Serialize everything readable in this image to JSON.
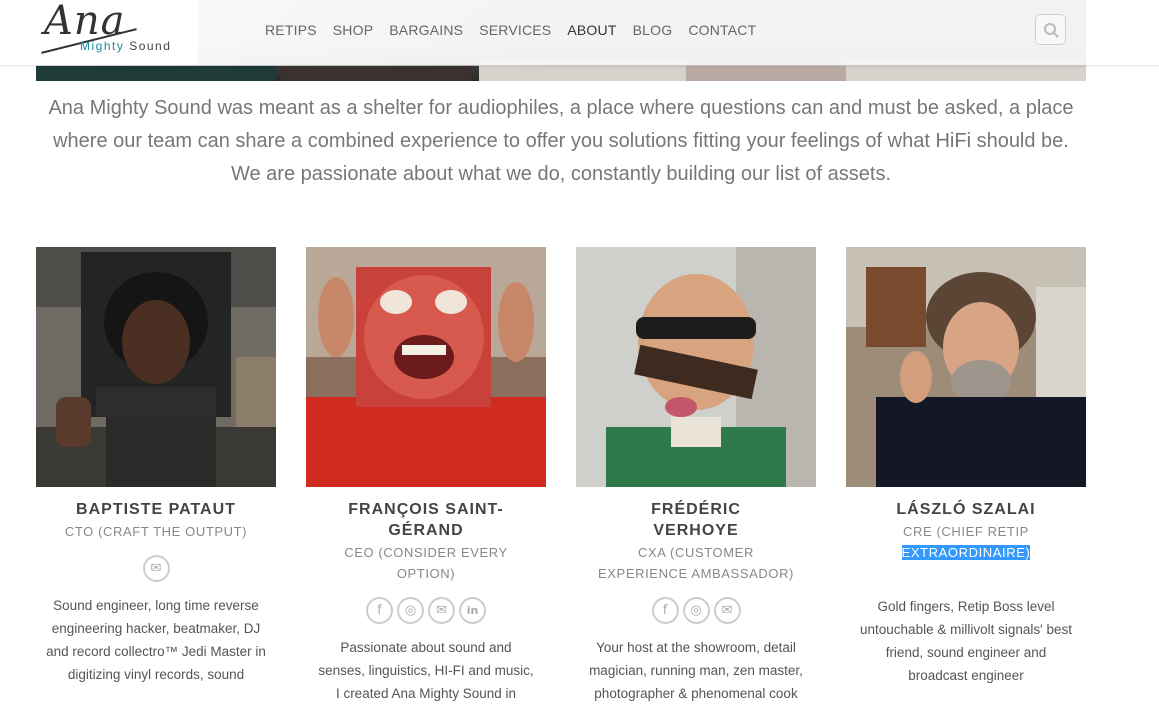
{
  "brand": {
    "script": "Ana",
    "tag_first": "Mighty",
    "tag_second": "Sound"
  },
  "nav": {
    "items": [
      "RETIPS",
      "SHOP",
      "BARGAINS",
      "SERVICES",
      "ABOUT",
      "BLOG",
      "CONTACT"
    ],
    "active": "ABOUT"
  },
  "intro": "Ana Mighty Sound was meant as a shelter for audiophiles, a place where questions can and must be asked, a place where our team can share a combined experience to offer you solutions fitting your feelings of what HiFi should be. We are passionate about what we do, constantly building our list of assets.",
  "team": [
    {
      "name": "BAPTISTE PATAUT",
      "role": "CTO (CRAFT THE OUTPUT)",
      "icons": [
        "email-icon"
      ],
      "bio": "Sound engineer, long time reverse engineering hacker, beatmaker, DJ and record collectro™ Jedi Master in digitizing vinyl records, sound"
    },
    {
      "name": "FRANÇOIS SAINT-GÉRAND",
      "role": "CEO (CONSIDER EVERY OPTION)",
      "icons": [
        "facebook-icon",
        "instagram-icon",
        "email-icon",
        "linkedin-icon"
      ],
      "bio": "Passionate about sound and senses, linguistics, HI-FI and music, I created Ana Mighty Sound in"
    },
    {
      "name": "FRÉDÉRIC VERHOYE",
      "role": "CXA (CUSTOMER EXPERIENCE AMBASSADOR)",
      "icons": [
        "facebook-icon",
        "instagram-icon",
        "email-icon"
      ],
      "bio": "Your host at the showroom, detail magician, running man, zen master, photographer & phenomenal cook"
    },
    {
      "name": "LÁSZLÓ SZALAI",
      "role_plain": "CRE (CHIEF RETIP",
      "role_highlight": "EXTRAORDINAIRE)",
      "icons": [],
      "bio": "Gold fingers, Retip Boss level untouchable & millivolt signals' best friend, sound engineer and broadcast engineer"
    }
  ]
}
